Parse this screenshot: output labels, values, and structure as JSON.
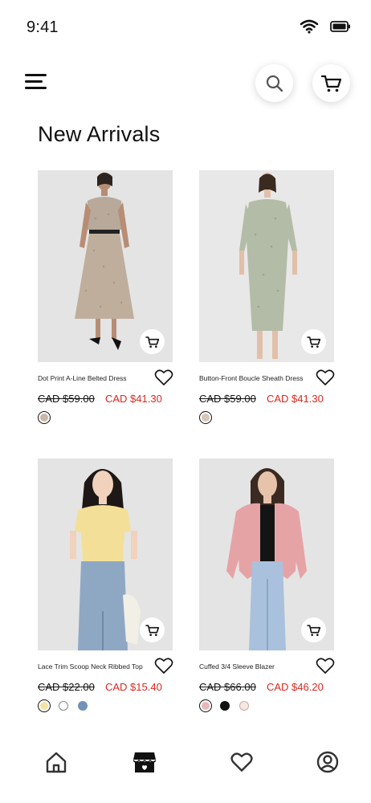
{
  "status_bar": {
    "time": "9:41",
    "icons": [
      "wifi-icon",
      "battery-icon"
    ]
  },
  "header": {
    "icons": [
      "menu-icon",
      "search-icon",
      "cart-icon"
    ]
  },
  "page": {
    "title": "New Arrivals"
  },
  "products": [
    {
      "name": "Dot Print A-Line Belted Dress",
      "old_price": "CAD $59.00",
      "new_price": "CAD $41.30",
      "swatches": [
        {
          "color": "#c9b8a8",
          "selected": true
        }
      ]
    },
    {
      "name": "Button-Front Boucle Sheath Dress",
      "old_price": "CAD $59.00",
      "new_price": "CAD $41.30",
      "swatches": [
        {
          "color": "#d8c6b6",
          "selected": true
        }
      ]
    },
    {
      "name": "Lace Trim Scoop Neck Ribbed Top",
      "old_price": "CAD $22.00",
      "new_price": "CAD $15.40",
      "swatches": [
        {
          "color": "#f5e3a8",
          "selected": true
        },
        {
          "color": "#ffffff",
          "selected": false
        },
        {
          "color": "#7391b8",
          "selected": false
        }
      ]
    },
    {
      "name": "Cuffed 3/4 Sleeve Blazer",
      "old_price": "CAD $66.00",
      "new_price": "CAD $46.20",
      "swatches": [
        {
          "color": "#e9b7b8",
          "selected": true
        },
        {
          "color": "#111111",
          "selected": false
        },
        {
          "color": "#f6e9e3",
          "selected": false
        }
      ]
    }
  ],
  "bottom_nav": {
    "items": [
      "home-icon",
      "store-icon",
      "heart-icon",
      "profile-icon"
    ],
    "active": "store-icon"
  },
  "colors": {
    "sale_price": "#d9291f",
    "text": "#111111"
  }
}
